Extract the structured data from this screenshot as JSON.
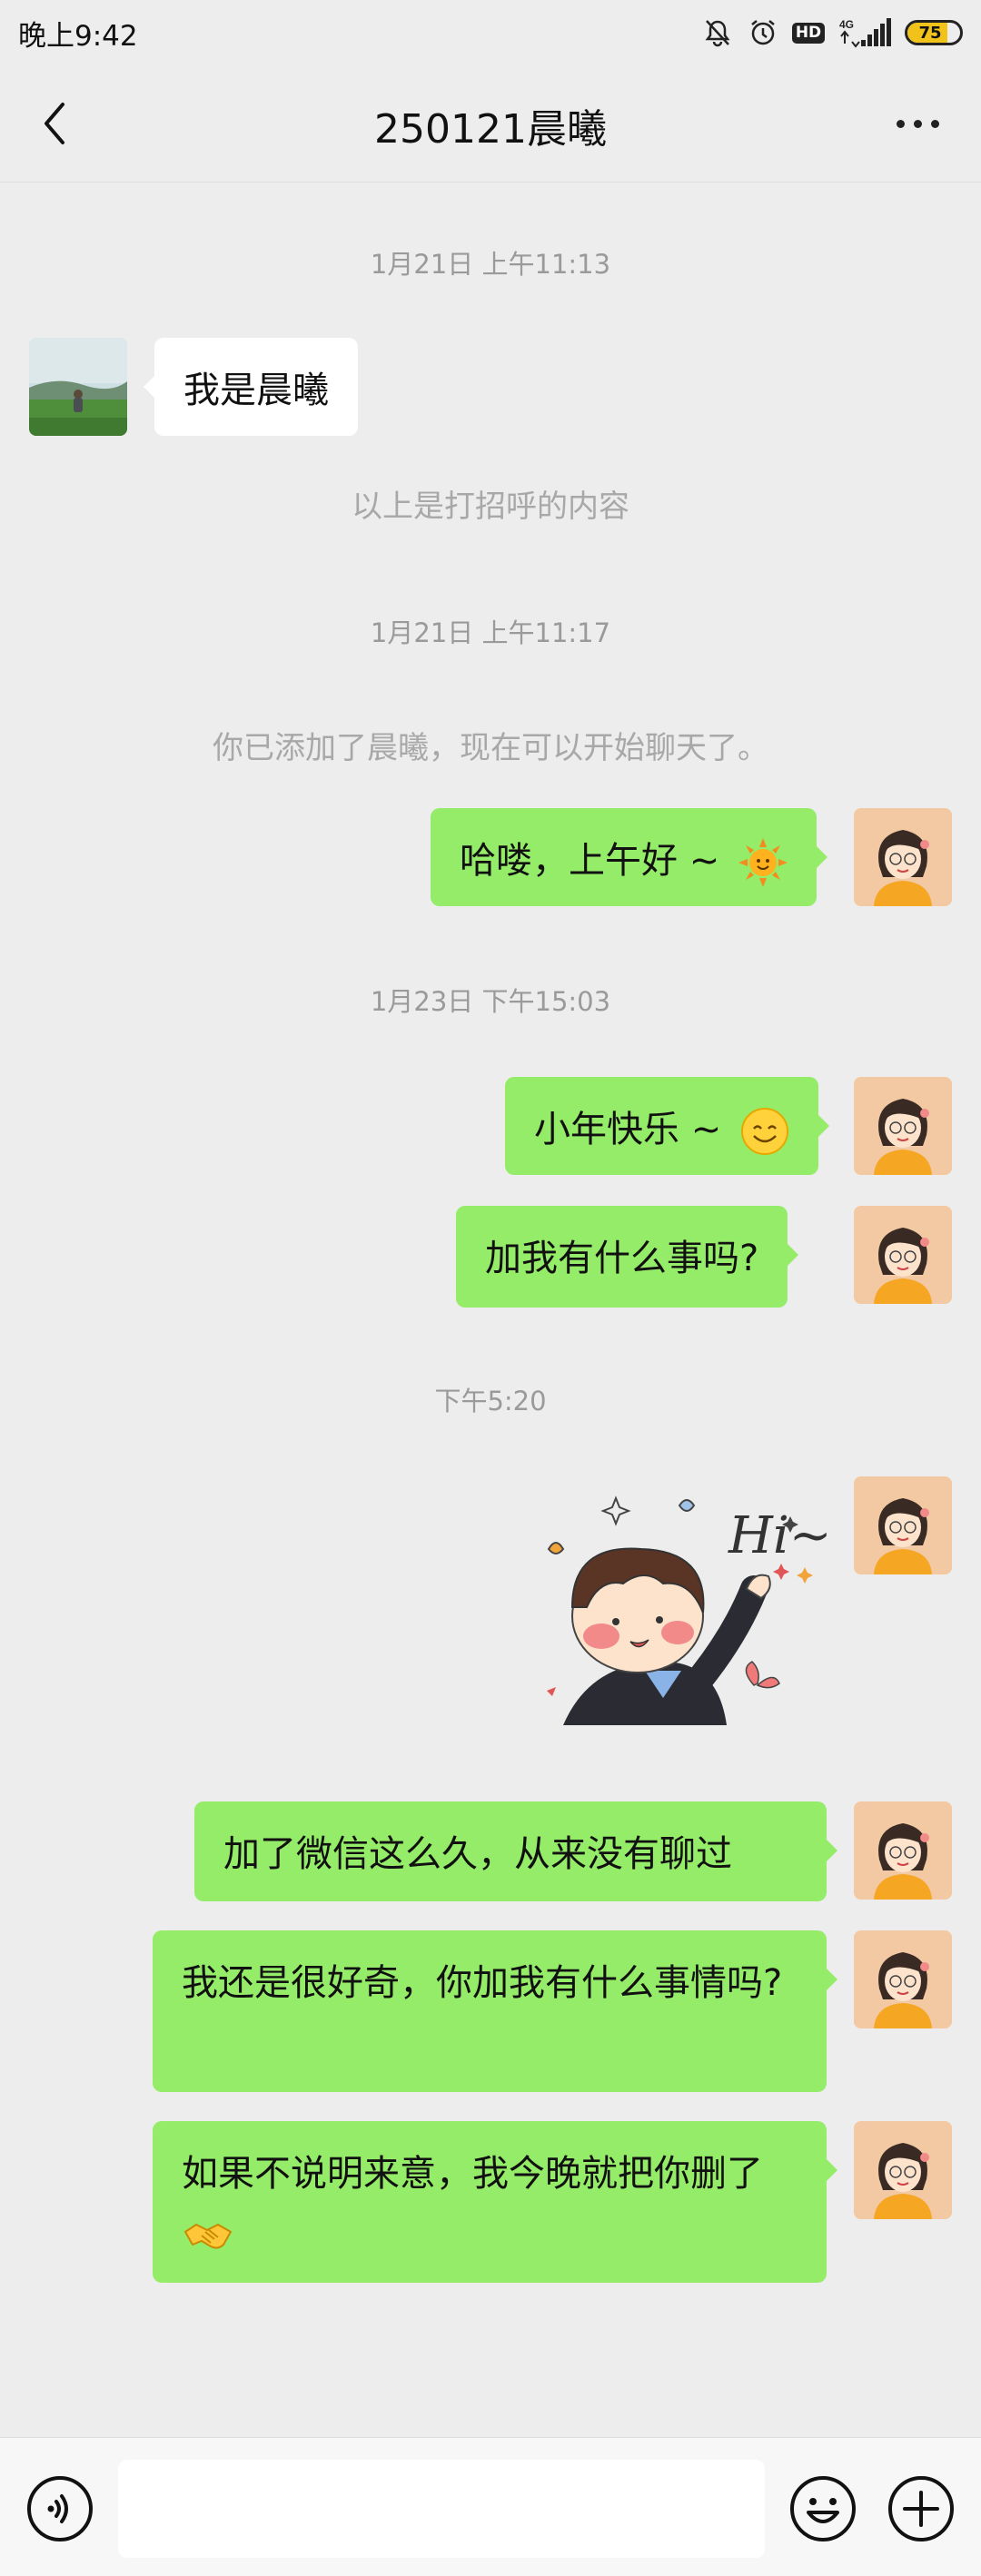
{
  "status_bar": {
    "time": "晚上9:42",
    "network": "4G",
    "hd": "HD",
    "battery_level": "75",
    "battery_fraction": 0.75
  },
  "header": {
    "title": "250121晨曦",
    "back_icon": "chevron-left-icon",
    "more_icon": "more-dots-icon"
  },
  "chat": {
    "timestamp_1": "1月21日 上午11:13",
    "msg_in_1": "我是晨曦",
    "system_1": "以上是打招呼的内容",
    "timestamp_2": "1月21日 上午11:17",
    "system_2": "你已添加了晨曦，现在可以开始聊天了。",
    "msg_out_1": "哈喽，上午好 ~",
    "timestamp_3": "1月23日 下午15:03",
    "msg_out_2": "小年快乐 ~",
    "msg_out_3": "加我有什么事吗?",
    "timestamp_4": "下午5:20",
    "sticker_text": "Hi~",
    "msg_out_4": "加了微信这么久，从来没有聊过",
    "msg_out_5": "我还是很好奇，你加我有什么事情吗?",
    "msg_out_6": "如果不说明来意，我今晚就把你删了"
  },
  "input_bar": {
    "value": "",
    "voice_icon": "voice-icon",
    "emoji_icon": "emoji-face-icon",
    "plus_icon": "plus-circle-icon"
  },
  "colors": {
    "background": "#ededed",
    "outgoing_bubble": "#95ec69",
    "incoming_bubble": "#ffffff",
    "timestamp_text": "#9a9a9a"
  }
}
